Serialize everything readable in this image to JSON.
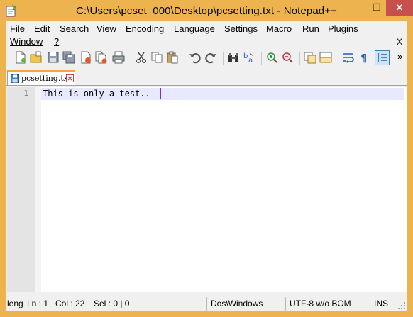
{
  "window": {
    "title": "C:\\Users\\pcset_000\\Desktop\\pcsetting.txt - Notepad++",
    "accent": "#ecb34f",
    "close_glyph": "✕",
    "min_glyph": "—",
    "max_glyph": "❐"
  },
  "menu": {
    "file": "File",
    "edit": "Edit",
    "search": "Search",
    "view": "View",
    "encoding": "Encoding",
    "language": "Language",
    "settings": "Settings",
    "macro": "Macro",
    "run": "Run",
    "plugins": "Plugins",
    "window": "Window",
    "help": "?",
    "close_doc": "X"
  },
  "toolbar": {
    "overflow": "»",
    "buttons": [
      "new-file-icon",
      "open-file-icon",
      "save-icon",
      "save-all-icon",
      "close-icon",
      "close-all-icon",
      "print-icon",
      "cut-icon",
      "copy-icon",
      "paste-icon",
      "undo-icon",
      "redo-icon",
      "find-icon",
      "replace-icon",
      "zoom-in-icon",
      "zoom-out-icon",
      "sync-vertical-icon",
      "sync-horizontal-icon",
      "word-wrap-icon",
      "show-all-chars-icon",
      "indent-guide-icon"
    ]
  },
  "tab": {
    "label": "pcsetting.txt"
  },
  "editor": {
    "line_number": "1",
    "text": "This is only a test.."
  },
  "status": {
    "length": "leng",
    "line": "Ln : 1",
    "col": "Col : 22",
    "sel": "Sel : 0 | 0",
    "eol": "Dos\\Windows",
    "encoding": "UTF-8 w/o BOM",
    "mode": "INS"
  }
}
